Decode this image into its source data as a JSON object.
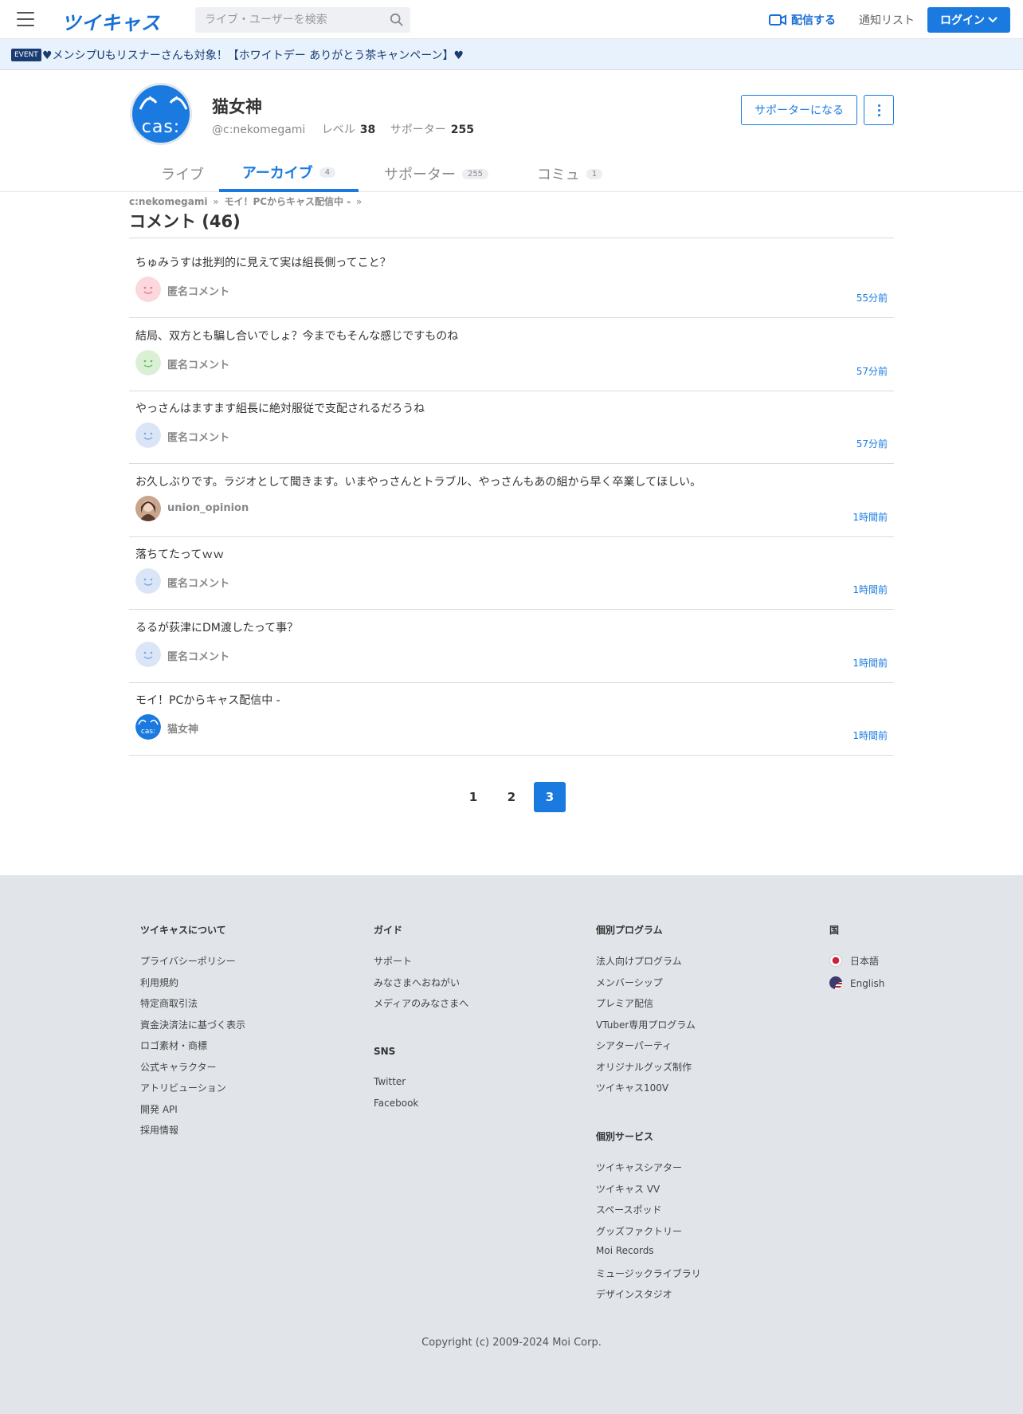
{
  "header": {
    "logo": "ツイキャス",
    "search_placeholder": "ライブ・ユーザーを検索",
    "broadcast_label": "配信する",
    "notify_label": "通知リスト",
    "login_label": "ログイン"
  },
  "event": {
    "badge": "EVENT",
    "text": "♥︎メンシプUもリスナーさんも︎対象！【ホワイトデー ありがとう茶キャンペーン】︎♥"
  },
  "profile": {
    "avatar_text": "cas:",
    "name": "猫女神",
    "handle": "@c:nekomegami",
    "level_label": "レベル",
    "level": "38",
    "supporter_label": "サポーター",
    "supporters": "255",
    "supporter_button": "サポーターになる"
  },
  "tabs": [
    {
      "label": "ライブ",
      "count": ""
    },
    {
      "label": "アーカイブ",
      "count": "4"
    },
    {
      "label": "サポーター",
      "count": "255"
    },
    {
      "label": "コミュ",
      "count": "1"
    }
  ],
  "breadcrumb": {
    "user": "c:nekomegami",
    "sep1": "»",
    "live": "モイ！PCからキャス配信中 -",
    "sep2": "»"
  },
  "section_title": "コメント (46)",
  "comments": [
    {
      "text": "ちゅみうすは批判的に見えて実は組長側ってこと？",
      "user": "匿名コメント",
      "time": "55分前",
      "avatar": "anon-pink"
    },
    {
      "text": "結局、双方とも騙し合いでしょ？今までもそんな感じですものね",
      "user": "匿名コメント",
      "time": "57分前",
      "avatar": "anon-green"
    },
    {
      "text": "やっさんはますます組長に絶対服従で支配されるだろうね",
      "user": "匿名コメント",
      "time": "57分前",
      "avatar": "anon-blue"
    },
    {
      "text": "お久しぶりです。ラジオとして聞きます。いまやっさんとトラブル、やっさんもあの組から早く卒業してほしい。",
      "user": "union_opinion",
      "time": "1時間前",
      "avatar": "photo"
    },
    {
      "text": "落ちてたってｗｗ",
      "user": "匿名コメント",
      "time": "1時間前",
      "avatar": "anon-blue"
    },
    {
      "text": "るるが荻津にDM渡したって事？",
      "user": "匿名コメント",
      "time": "1時間前",
      "avatar": "anon-blue"
    },
    {
      "text": "モイ！PCからキャス配信中 -",
      "user": "猫女神",
      "time": "1時間前",
      "avatar": "cas"
    }
  ],
  "pagination": [
    "1",
    "2",
    "3"
  ],
  "pagination_active": "3",
  "footer": {
    "about": {
      "heading": "ツイキャスについて",
      "links": [
        "プライバシーポリシー",
        "利用規約",
        "特定商取引法",
        "資金決済法に基づく表示",
        "ロゴ素材・商標",
        "公式キャラクター",
        "アトリビューション",
        "開発 API",
        "採用情報"
      ]
    },
    "guide": {
      "heading": "ガイド",
      "links": [
        "サポート",
        "みなさまへおねがい",
        "メディアのみなさまへ"
      ]
    },
    "sns": {
      "heading": "SNS",
      "links": [
        "Twitter",
        "Facebook"
      ]
    },
    "programs": {
      "heading": "個別プログラム",
      "links": [
        "法人向けプログラム",
        "メンバーシップ",
        "プレミア配信",
        "VTuber専用プログラム",
        "シアターパーティ",
        "オリジナルグッズ制作",
        "ツイキャス100V"
      ]
    },
    "services": {
      "heading": "個別サービス",
      "links": [
        "ツイキャスシアター",
        "ツイキャス VV",
        "スペースポッド",
        "グッズファクトリー",
        "Moi Records",
        "ミュージックライブラリ",
        "デザインスタジオ"
      ]
    },
    "country": {
      "heading": "国",
      "links": [
        "日本語",
        "English"
      ]
    },
    "copyright": "Copyright (c) 2009-2024 Moi Corp."
  },
  "colors": {
    "accent": "#1a7ae0",
    "footer_bg": "#e1e4e9",
    "event_bg": "#e8f2fd"
  }
}
